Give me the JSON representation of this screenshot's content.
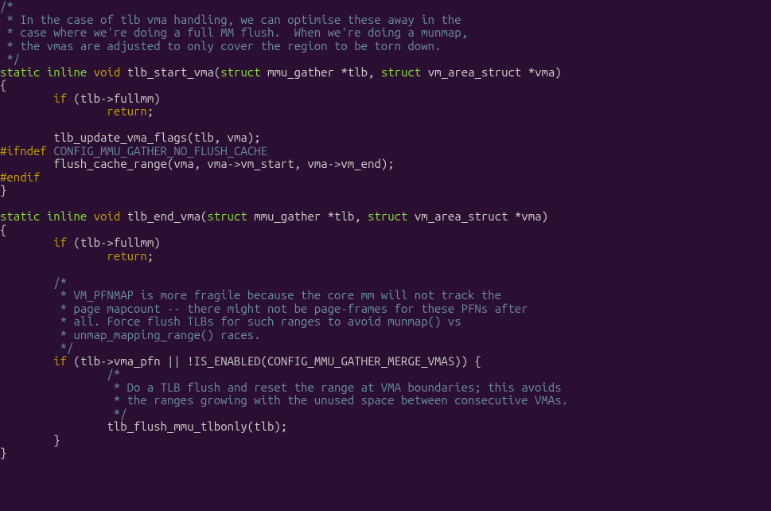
{
  "code": {
    "lines": [
      {
        "segments": [
          {
            "cls": "c-comment",
            "t": "/*"
          }
        ]
      },
      {
        "segments": [
          {
            "cls": "c-comment",
            "t": " * In the case of tlb vma handling, we can optimise these away in the"
          }
        ]
      },
      {
        "segments": [
          {
            "cls": "c-comment",
            "t": " * case where we're doing a full MM flush.  When we're doing a munmap,"
          }
        ]
      },
      {
        "segments": [
          {
            "cls": "c-comment",
            "t": " * the vmas are adjusted to only cover the region to be torn down."
          }
        ]
      },
      {
        "segments": [
          {
            "cls": "c-comment",
            "t": " */"
          }
        ]
      },
      {
        "segments": [
          {
            "cls": "c-keyword",
            "t": "static"
          },
          {
            "cls": "c-punct",
            "t": " "
          },
          {
            "cls": "c-keyword",
            "t": "inline"
          },
          {
            "cls": "c-punct",
            "t": " "
          },
          {
            "cls": "c-type",
            "t": "void"
          },
          {
            "cls": "c-punct",
            "t": " "
          },
          {
            "cls": "c-func",
            "t": "tlb_start_vma("
          },
          {
            "cls": "c-keyword",
            "t": "struct"
          },
          {
            "cls": "c-punct",
            "t": " "
          },
          {
            "cls": "c-ident",
            "t": "mmu_gather *tlb, "
          },
          {
            "cls": "c-keyword",
            "t": "struct"
          },
          {
            "cls": "c-punct",
            "t": " "
          },
          {
            "cls": "c-ident",
            "t": "vm_area_struct *vma)"
          }
        ]
      },
      {
        "segments": [
          {
            "cls": "c-punct",
            "t": "{"
          }
        ]
      },
      {
        "segments": [
          {
            "cls": "c-punct",
            "t": "        "
          },
          {
            "cls": "c-control",
            "t": "if"
          },
          {
            "cls": "c-punct",
            "t": " (tlb->fullmm)"
          }
        ]
      },
      {
        "segments": [
          {
            "cls": "c-punct",
            "t": "                "
          },
          {
            "cls": "c-control",
            "t": "return"
          },
          {
            "cls": "c-punct",
            "t": ";"
          }
        ]
      },
      {
        "segments": [
          {
            "cls": "c-punct",
            "t": ""
          }
        ]
      },
      {
        "segments": [
          {
            "cls": "c-punct",
            "t": "        tlb_update_vma_flags(tlb, vma);"
          }
        ]
      },
      {
        "segments": [
          {
            "cls": "c-preproc-kw",
            "t": "#ifndef"
          },
          {
            "cls": "c-preproc",
            "t": " CONFIG_MMU_GATHER_NO_FLUSH_CACHE"
          }
        ]
      },
      {
        "segments": [
          {
            "cls": "c-punct",
            "t": "        flush_cache_range(vma, vma->vm_start, vma->vm_end);"
          }
        ]
      },
      {
        "segments": [
          {
            "cls": "c-preproc-kw",
            "t": "#endif"
          }
        ]
      },
      {
        "segments": [
          {
            "cls": "c-punct",
            "t": "}"
          }
        ]
      },
      {
        "segments": [
          {
            "cls": "c-punct",
            "t": ""
          }
        ]
      },
      {
        "segments": [
          {
            "cls": "c-keyword",
            "t": "static"
          },
          {
            "cls": "c-punct",
            "t": " "
          },
          {
            "cls": "c-keyword",
            "t": "inline"
          },
          {
            "cls": "c-punct",
            "t": " "
          },
          {
            "cls": "c-type",
            "t": "void"
          },
          {
            "cls": "c-punct",
            "t": " "
          },
          {
            "cls": "c-func",
            "t": "tlb_end_vma("
          },
          {
            "cls": "c-keyword",
            "t": "struct"
          },
          {
            "cls": "c-punct",
            "t": " "
          },
          {
            "cls": "c-ident",
            "t": "mmu_gather *tlb, "
          },
          {
            "cls": "c-keyword",
            "t": "struct"
          },
          {
            "cls": "c-punct",
            "t": " "
          },
          {
            "cls": "c-ident",
            "t": "vm_area_struct *vma)"
          }
        ]
      },
      {
        "segments": [
          {
            "cls": "c-punct",
            "t": "{"
          }
        ]
      },
      {
        "segments": [
          {
            "cls": "c-punct",
            "t": "        "
          },
          {
            "cls": "c-control",
            "t": "if"
          },
          {
            "cls": "c-punct",
            "t": " (tlb->fullmm)"
          }
        ]
      },
      {
        "segments": [
          {
            "cls": "c-punct",
            "t": "                "
          },
          {
            "cls": "c-control",
            "t": "return"
          },
          {
            "cls": "c-punct",
            "t": ";"
          }
        ]
      },
      {
        "segments": [
          {
            "cls": "c-punct",
            "t": ""
          }
        ]
      },
      {
        "segments": [
          {
            "cls": "c-comment",
            "t": "        /*"
          }
        ]
      },
      {
        "segments": [
          {
            "cls": "c-comment",
            "t": "         * VM_PFNMAP is more fragile because the core mm will not track the"
          }
        ]
      },
      {
        "segments": [
          {
            "cls": "c-comment",
            "t": "         * page mapcount -- there might not be page-frames for these PFNs after"
          }
        ]
      },
      {
        "segments": [
          {
            "cls": "c-comment",
            "t": "         * all. Force flush TLBs for such ranges to avoid munmap() vs"
          }
        ]
      },
      {
        "segments": [
          {
            "cls": "c-comment",
            "t": "         * unmap_mapping_range() races."
          }
        ]
      },
      {
        "segments": [
          {
            "cls": "c-comment",
            "t": "         */"
          }
        ]
      },
      {
        "segments": [
          {
            "cls": "c-punct",
            "t": "        "
          },
          {
            "cls": "c-control",
            "t": "if"
          },
          {
            "cls": "c-punct",
            "t": " (tlb->vma_pfn || !IS_ENABLED(CONFIG_MMU_GATHER_MERGE_VMAS)) {"
          }
        ]
      },
      {
        "segments": [
          {
            "cls": "c-comment",
            "t": "                /*"
          }
        ]
      },
      {
        "segments": [
          {
            "cls": "c-comment",
            "t": "                 * Do a TLB flush and reset the range at VMA boundaries; this avoids"
          }
        ]
      },
      {
        "segments": [
          {
            "cls": "c-comment",
            "t": "                 * the ranges growing with the unused space between consecutive VMAs."
          }
        ]
      },
      {
        "segments": [
          {
            "cls": "c-comment",
            "t": "                 */"
          }
        ]
      },
      {
        "segments": [
          {
            "cls": "c-punct",
            "t": "                tlb_flush_mmu_tlbonly(tlb);"
          }
        ]
      },
      {
        "segments": [
          {
            "cls": "c-punct",
            "t": "        }"
          }
        ]
      },
      {
        "segments": [
          {
            "cls": "c-punct",
            "t": "}"
          }
        ]
      }
    ]
  }
}
